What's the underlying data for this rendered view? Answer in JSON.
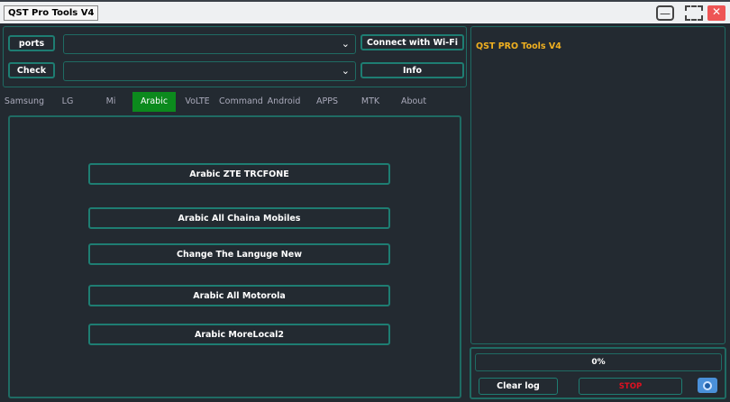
{
  "window": {
    "title": "QST Pro Tools V4"
  },
  "top": {
    "ports": "ports",
    "check": "Check",
    "wifi": "Connect with Wi-Fi",
    "info": "Info"
  },
  "tabs": [
    "Samsung",
    "LG",
    "Mi",
    "Arabic",
    "VoLTE",
    "Command",
    "Android",
    "APPS",
    "MTK",
    "About"
  ],
  "active_tab": "Arabic",
  "actions": [
    "Arabic ZTE TRCFONE",
    "Arabic All Chaina Mobiles",
    "Change The Languge New",
    "Arabic All Motorola",
    "Arabic MoreLocal2"
  ],
  "log": {
    "text": "QST PRO Tools V4"
  },
  "progress": {
    "label": "0%",
    "value": 0
  },
  "bottom": {
    "clear": "Clear log",
    "stop": "STOP"
  },
  "colors": {
    "accent": "#1e7d72",
    "active_tab": "#0c8a1d",
    "log_text": "#f0b020",
    "stop": "#e01020"
  }
}
